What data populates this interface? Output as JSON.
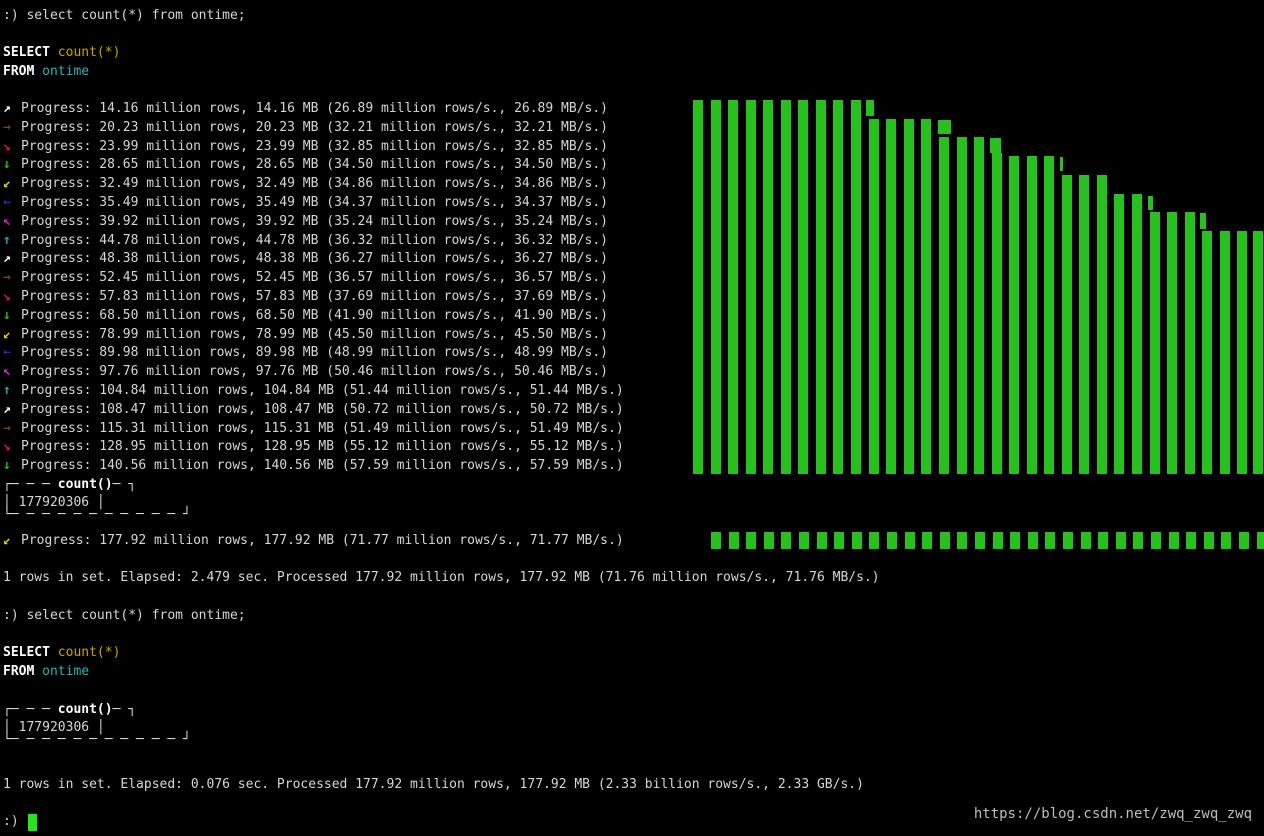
{
  "terminal": {
    "query_command": ":) select count(*) from ontime;",
    "sql": {
      "select_kw": "SELECT",
      "select_expr": "count(*)",
      "from_kw": "FROM",
      "from_table": "ontime"
    },
    "progress_lines": [
      {
        "arrow": "↗",
        "color": "#ffffff",
        "text": "Progress: 14.16 million rows, 14.16 MB (26.89 million rows/s., 26.89 MB/s.)"
      },
      {
        "arrow": "→",
        "color": "#7a3b3b",
        "text": "Progress: 20.23 million rows, 20.23 MB (32.21 million rows/s., 32.21 MB/s.)"
      },
      {
        "arrow": "↘",
        "color": "#e02020",
        "text": "Progress: 23.99 million rows, 23.99 MB (32.85 million rows/s., 32.85 MB/s.)"
      },
      {
        "arrow": "↓",
        "color": "#27c01f",
        "text": "Progress: 28.65 million rows, 28.65 MB (34.50 million rows/s., 34.50 MB/s.)"
      },
      {
        "arrow": "↙",
        "color": "#e8d000",
        "text": "Progress: 32.49 million rows, 32.49 MB (34.86 million rows/s., 34.86 MB/s.)"
      },
      {
        "arrow": "←",
        "color": "#2030c0",
        "text": "Progress: 35.49 million rows, 35.49 MB (34.37 million rows/s., 34.37 MB/s.)"
      },
      {
        "arrow": "↖",
        "color": "#e020e0",
        "text": "Progress: 39.92 million rows, 39.92 MB (35.24 million rows/s., 35.24 MB/s.)"
      },
      {
        "arrow": "↑",
        "color": "#20b0c0",
        "text": "Progress: 44.78 million rows, 44.78 MB (36.32 million rows/s., 36.32 MB/s.)"
      },
      {
        "arrow": "↗",
        "color": "#ffffff",
        "text": "Progress: 48.38 million rows, 48.38 MB (36.27 million rows/s., 36.27 MB/s.)"
      },
      {
        "arrow": "→",
        "color": "#7a3b3b",
        "text": "Progress: 52.45 million rows, 52.45 MB (36.57 million rows/s., 36.57 MB/s.)"
      },
      {
        "arrow": "↘",
        "color": "#e02020",
        "text": "Progress: 57.83 million rows, 57.83 MB (37.69 million rows/s., 37.69 MB/s.)"
      },
      {
        "arrow": "↓",
        "color": "#27c01f",
        "text": "Progress: 68.50 million rows, 68.50 MB (41.90 million rows/s., 41.90 MB/s.)"
      },
      {
        "arrow": "↙",
        "color": "#e8d000",
        "text": "Progress: 78.99 million rows, 78.99 MB (45.50 million rows/s., 45.50 MB/s.)"
      },
      {
        "arrow": "←",
        "color": "#2030c0",
        "text": "Progress: 89.98 million rows, 89.98 MB (48.99 million rows/s., 48.99 MB/s.)"
      },
      {
        "arrow": "↖",
        "color": "#e020e0",
        "text": "Progress: 97.76 million rows, 97.76 MB (50.46 million rows/s., 50.46 MB/s.)"
      },
      {
        "arrow": "↑",
        "color": "#20b0c0",
        "text": "Progress: 104.84 million rows, 104.84 MB (51.44 million rows/s., 51.44 MB/s.)"
      },
      {
        "arrow": "↗",
        "color": "#ffffff",
        "text": "Progress: 108.47 million rows, 108.47 MB (50.72 million rows/s., 50.72 MB/s.)"
      },
      {
        "arrow": "→",
        "color": "#7a3b3b",
        "text": "Progress: 115.31 million rows, 115.31 MB (51.49 million rows/s., 51.49 MB/s.)"
      },
      {
        "arrow": "↘",
        "color": "#e02020",
        "text": "Progress: 128.95 million rows, 128.95 MB (55.12 million rows/s., 55.12 MB/s.)"
      },
      {
        "arrow": "↓",
        "color": "#27c01f",
        "text": "Progress: 140.56 million rows, 140.56 MB (57.59 million rows/s., 57.59 MB/s.)"
      }
    ],
    "result_table_1": {
      "header": "count()",
      "value": "177920306"
    },
    "final_progress": {
      "arrow": "↙",
      "color": "#e8d000",
      "text": "Progress: 177.92 million rows, 177.92 MB (71.77 million rows/s., 71.77 MB/s.)"
    },
    "summary_1": "1 rows in set. Elapsed: 2.479 sec. Processed 177.92 million rows, 177.92 MB (71.76 million rows/s., 71.76 MB/s.)",
    "query_command_2": ":) select count(*) from ontime;",
    "result_table_2": {
      "header": "count()",
      "value": "177920306"
    },
    "summary_2": "1 rows in set. Elapsed: 0.076 sec. Processed 177.92 million rows, 177.92 MB (2.33 billion rows/s., 2.33 GB/s.)",
    "prompt": ":)",
    "bar_color": "#27c01f"
  },
  "watermark": "https://blog.csdn.net/zwq_zwq_zwq"
}
